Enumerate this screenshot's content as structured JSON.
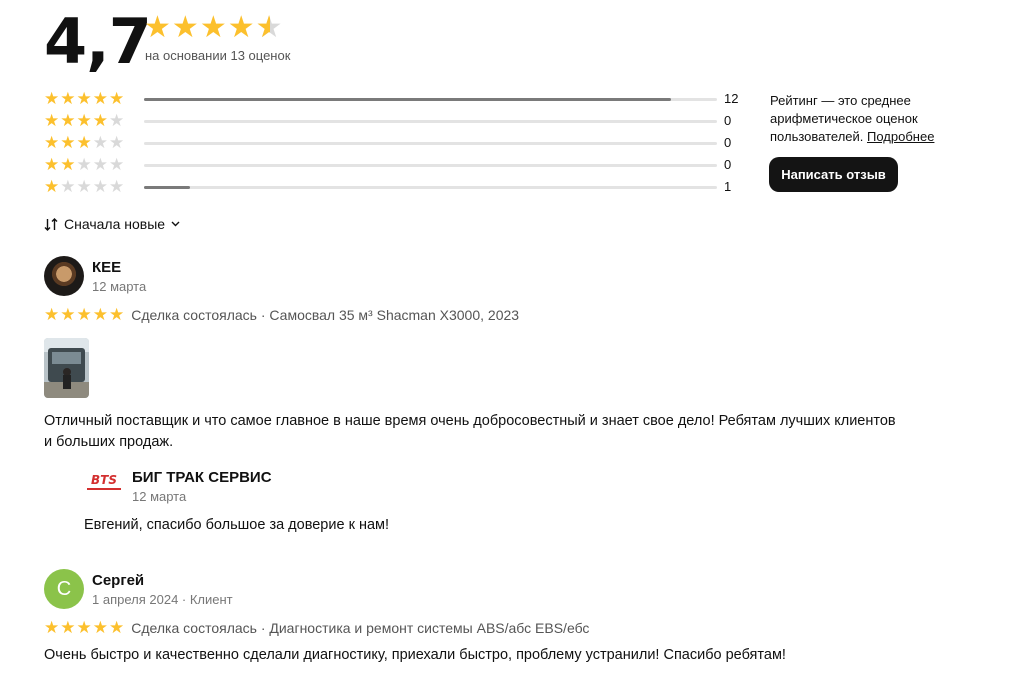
{
  "summary": {
    "rating_text": "4,7",
    "rating_value": 4.7,
    "basis": "на основании 13 оценок"
  },
  "distribution": [
    {
      "stars": 5,
      "count": "12",
      "fraction": 0.92
    },
    {
      "stars": 4,
      "count": "0",
      "fraction": 0
    },
    {
      "stars": 3,
      "count": "0",
      "fraction": 0
    },
    {
      "stars": 2,
      "count": "0",
      "fraction": 0
    },
    {
      "stars": 1,
      "count": "1",
      "fraction": 0.08
    }
  ],
  "info": {
    "text": "Рейтинг — это среднее арифметическое оценок пользователей.",
    "link": "Подробнее"
  },
  "write_button": "Написать отзыв",
  "sort": {
    "icon": "sort-arrows-icon",
    "label": "Сначала новые",
    "chevron": "chevron-down-icon"
  },
  "reviews": [
    {
      "author": "КЕЕ",
      "date": "12 марта",
      "stars": 5,
      "meta": "Сделка состоялась · Самосвал 35 м³ Shacman X3000, 2023",
      "text": "Отличный поставщик и что самое главное в наше время очень добросовестный и знает свое дело! Ребятам лучших клиентов и больших продаж.",
      "reply": {
        "logo_text": "BTS",
        "author": "БИГ ТРАК СЕРВИС",
        "date": "12 марта",
        "text": "Евгений, спасибо большое за доверие к нам!"
      }
    },
    {
      "author": "Сергей",
      "avatar_letter": "С",
      "date": "1 апреля 2024 · Клиент",
      "stars": 5,
      "meta": "Сделка состоялась · Диагностика и ремонт системы ABS/абс EBS/ебс",
      "text": "Очень быстро и качественно сделали диагностику, приехали быстро, проблему устранили! Спасибо ребятам!"
    }
  ],
  "colors": {
    "star": "#fcc02d",
    "star_empty": "#d9d9d9",
    "button_bg": "#141414",
    "avatar_green": "#8bc34a"
  }
}
